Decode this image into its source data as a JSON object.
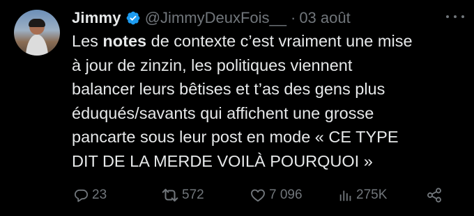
{
  "tweet": {
    "author_name": "Jimmy",
    "handle": "@JimmyDeuxFois__",
    "separator": "·",
    "date": "03 août",
    "text_lines": [
      {
        "pre": "Les ",
        "bold": "notes",
        "post": " de contexte c’est vraiment une mise"
      },
      {
        "pre": "à jour de zinzin, les politiques viennent",
        "bold": "",
        "post": ""
      },
      {
        "pre": "balancer leurs bêtises et t’as des gens plus",
        "bold": "",
        "post": ""
      },
      {
        "pre": "éduqués/savants qui affichent une grosse",
        "bold": "",
        "post": ""
      },
      {
        "pre": "pancarte sous leur post en mode « CE TYPE",
        "bold": "",
        "post": ""
      },
      {
        "pre": "DIT DE LA MERDE VOILÀ POURQUOI »",
        "bold": "",
        "post": ""
      }
    ]
  },
  "actions": {
    "replies": "23",
    "retweets": "572",
    "likes": "7 096",
    "views": "275K"
  },
  "icons": {
    "verified": "verified-badge-icon",
    "reply": "reply-icon",
    "retweet": "retweet-icon",
    "like": "heart-icon",
    "views": "views-icon",
    "share": "share-icon",
    "more": "more-icon"
  },
  "colors": {
    "background": "#000000",
    "text": "#e7e9ea",
    "muted": "#71767b",
    "verified": "#1d9bf0"
  }
}
